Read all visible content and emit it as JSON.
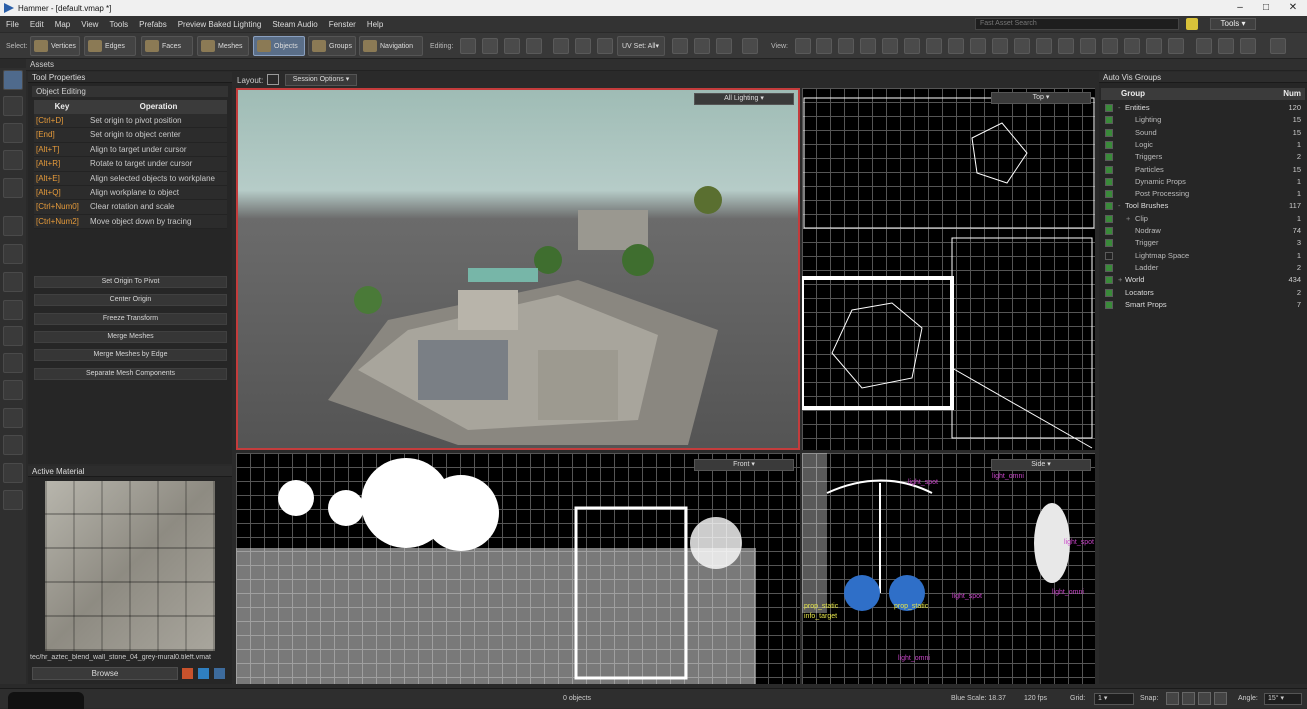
{
  "title": "Hammer - [default.vmap *]",
  "menu": [
    "File",
    "Edit",
    "Map",
    "View",
    "Tools",
    "Prefabs",
    "Preview Baked Lighting",
    "Steam Audio",
    "Fenster",
    "Help"
  ],
  "search_placeholder": "Fast Asset Search",
  "tools_label": "Tools",
  "toolbar": {
    "select_label": "Select:",
    "modes": [
      "Vertices",
      "Edges",
      "Faces",
      "Meshes",
      "Objects",
      "Groups",
      "Navigation"
    ],
    "editing_label": "Editing:",
    "uvset": "UV Set: All",
    "view_label": "View:"
  },
  "assets_label": "Assets",
  "tool_properties": {
    "title": "Tool Properties",
    "section": "Object Editing",
    "col_key": "Key",
    "col_op": "Operation",
    "rows": [
      {
        "k": "[Ctrl+D]",
        "o": "Set origin to pivot position"
      },
      {
        "k": "[End]",
        "o": "Set origin to object center"
      },
      {
        "k": "[Alt+T]",
        "o": "Align to target under cursor"
      },
      {
        "k": "[Alt+R]",
        "o": "Rotate to target under cursor"
      },
      {
        "k": "[Alt+E]",
        "o": "Align selected objects to workplane"
      },
      {
        "k": "[Alt+Q]",
        "o": "Align workplane to object"
      },
      {
        "k": "[Ctrl+Num0]",
        "o": "Clear rotation and scale"
      },
      {
        "k": "[Ctrl+Num2]",
        "o": "Move object down by tracing"
      }
    ],
    "buttons": [
      "Set Origin To Pivot",
      "Center Origin",
      "Freeze Transform",
      "Merge Meshes",
      "Merge Meshes by Edge",
      "Separate Mesh Components"
    ]
  },
  "active_material": {
    "title": "Active Material",
    "name": "tec/hr_aztec_blend_wall_stone_04_grey-mural0.tileft.vmat",
    "browse": "Browse"
  },
  "layout": {
    "label": "Layout:",
    "session": "Session Options"
  },
  "viewports": {
    "persp": "All Lighting",
    "top": "Top",
    "front": "Front",
    "side": "Side"
  },
  "autovis": {
    "title": "Auto Vis Groups",
    "col_group": "Group",
    "col_num": "Num",
    "rows": [
      {
        "g": "Entities",
        "n": "120",
        "lvl": 0,
        "exp": "-",
        "on": true
      },
      {
        "g": "Lighting",
        "n": "15",
        "lvl": 1,
        "on": true
      },
      {
        "g": "Sound",
        "n": "15",
        "lvl": 1,
        "on": true
      },
      {
        "g": "Logic",
        "n": "1",
        "lvl": 1,
        "on": true
      },
      {
        "g": "Triggers",
        "n": "2",
        "lvl": 1,
        "on": true
      },
      {
        "g": "Particles",
        "n": "15",
        "lvl": 1,
        "on": true
      },
      {
        "g": "Dynamic Props",
        "n": "1",
        "lvl": 1,
        "on": true
      },
      {
        "g": "Post Processing",
        "n": "1",
        "lvl": 1,
        "on": true
      },
      {
        "g": "Tool Brushes",
        "n": "117",
        "lvl": 0,
        "exp": "-",
        "on": true
      },
      {
        "g": "Clip",
        "n": "1",
        "lvl": 1,
        "exp": "+",
        "on": true
      },
      {
        "g": "Nodraw",
        "n": "74",
        "lvl": 1,
        "on": true
      },
      {
        "g": "Trigger",
        "n": "3",
        "lvl": 1,
        "on": true
      },
      {
        "g": "Lightmap Space",
        "n": "1",
        "lvl": 1,
        "on": false
      },
      {
        "g": "Ladder",
        "n": "2",
        "lvl": 1,
        "on": true
      },
      {
        "g": "World",
        "n": "434",
        "lvl": 0,
        "exp": "+",
        "on": true
      },
      {
        "g": "Locators",
        "n": "2",
        "lvl": 0,
        "on": true
      },
      {
        "g": "Smart Props",
        "n": "7",
        "lvl": 0,
        "on": true
      }
    ]
  },
  "side_labels": [
    "light_spot",
    "light_omni",
    "prop_static",
    "prop_static",
    "info_target",
    "light_spot",
    "light_omni",
    "light_spot",
    "light_omni"
  ],
  "status": {
    "objects": "0 objects",
    "blue_scale": "Blue Scale: 18.37",
    "fps": "120 fps",
    "grid_label": "Grid:",
    "grid_val": "1",
    "snap_label": "Snap:",
    "angle_label": "Angle:",
    "angle_val": "15°"
  },
  "colors": {
    "accent": "#c43c3c",
    "key": "#e69b3b",
    "select": "#5a6e88"
  }
}
